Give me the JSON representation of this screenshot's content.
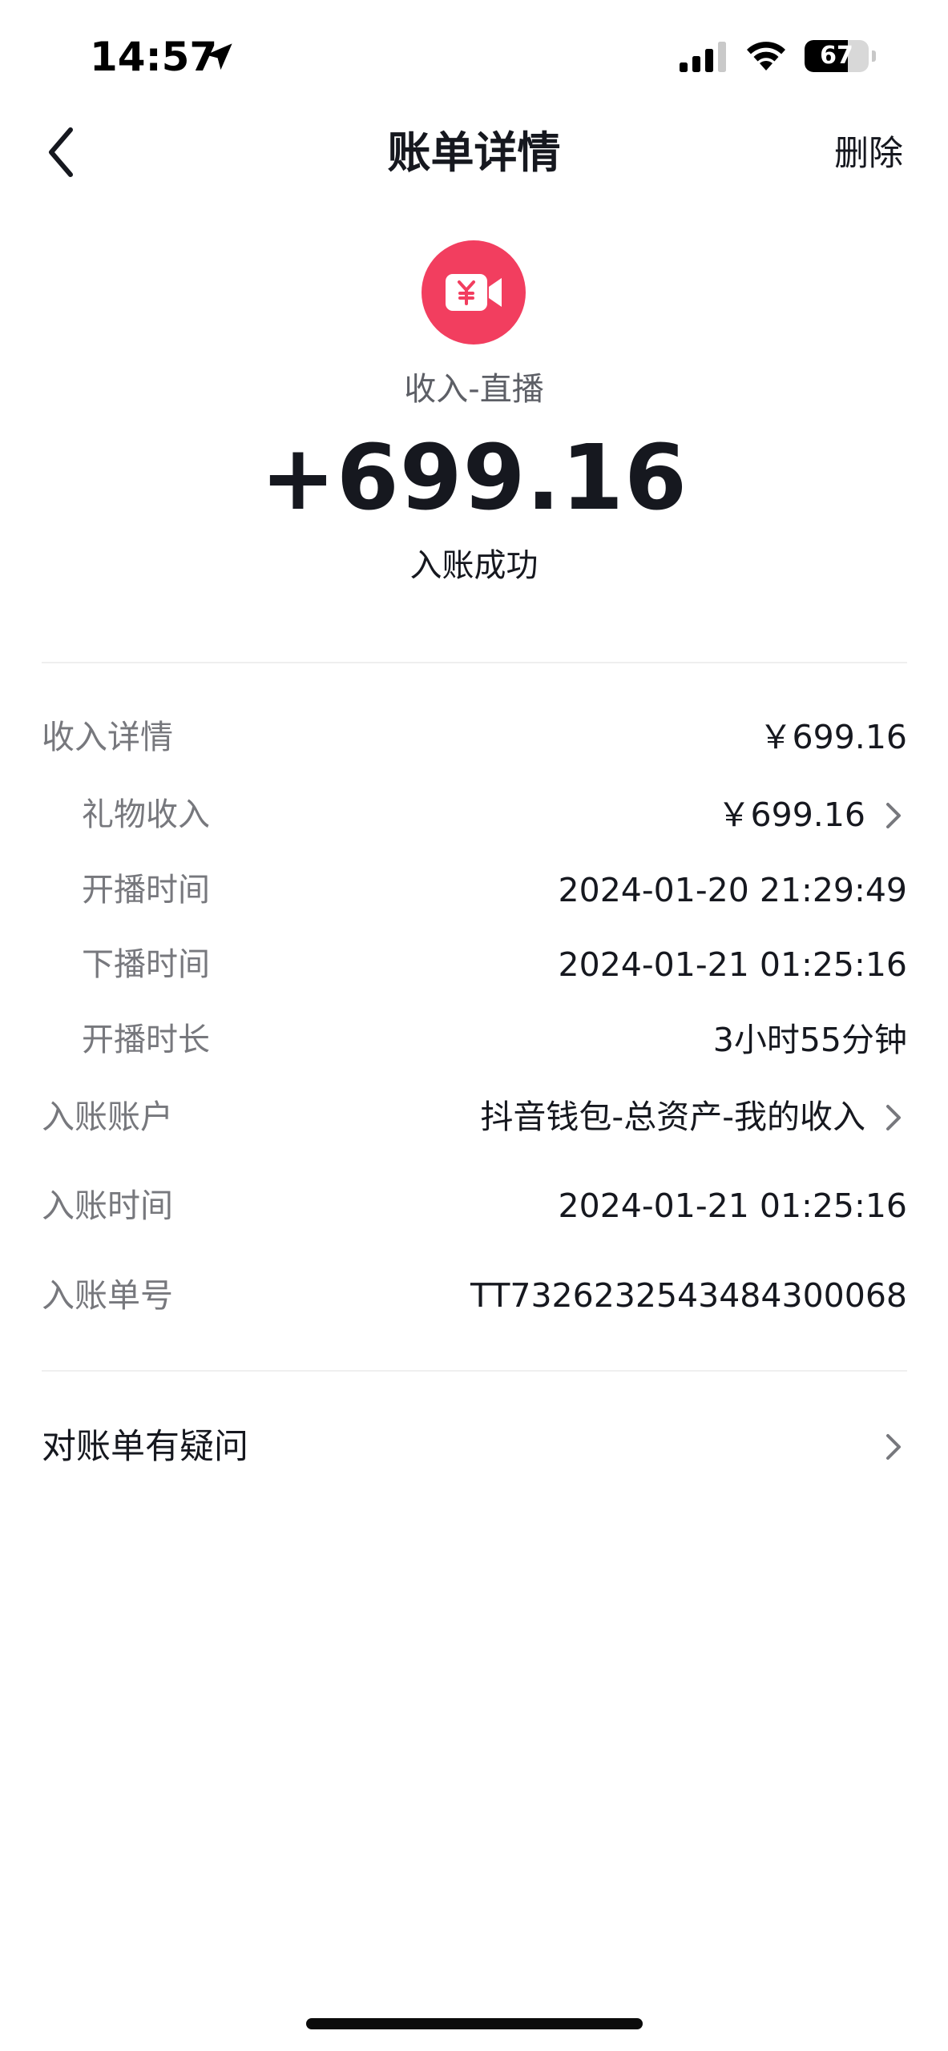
{
  "status_bar": {
    "time": "14:57",
    "battery_level": "67",
    "battery_fraction": 0.67,
    "icons": [
      "location-arrow-icon",
      "cellular-signal-icon",
      "wifi-icon",
      "battery-icon"
    ]
  },
  "nav": {
    "title": "账单详情",
    "delete_label": "删除",
    "back_icon": "chevron-left-icon"
  },
  "hero": {
    "icon": "live-stream-yuan-icon",
    "icon_color": "#f23e5f",
    "category": "收入-直播",
    "amount": "+699.16",
    "status": "入账成功"
  },
  "details": {
    "income_detail": {
      "label": "收入详情",
      "value": "￥699.16"
    },
    "gift_income": {
      "label": "礼物收入",
      "value": "￥699.16"
    },
    "start_time": {
      "label": "开播时间",
      "value": "2024-01-20 21:29:49"
    },
    "end_time": {
      "label": "下播时间",
      "value": "2024-01-21 01:25:16"
    },
    "duration": {
      "label": "开播时长",
      "value": "3小时55分钟"
    },
    "account": {
      "label": "入账账户",
      "value": "抖音钱包-总资产-我的收入"
    },
    "credit_time": {
      "label": "入账时间",
      "value": "2024-01-21 01:25:16"
    },
    "order_no": {
      "label": "入账单号",
      "value": "TT7326232543484300068"
    }
  },
  "query": {
    "label": "对账单有疑问"
  },
  "colors": {
    "text_primary": "#16181f",
    "text_secondary": "#77787d",
    "accent": "#f23e5f",
    "divider": "#efefef"
  }
}
